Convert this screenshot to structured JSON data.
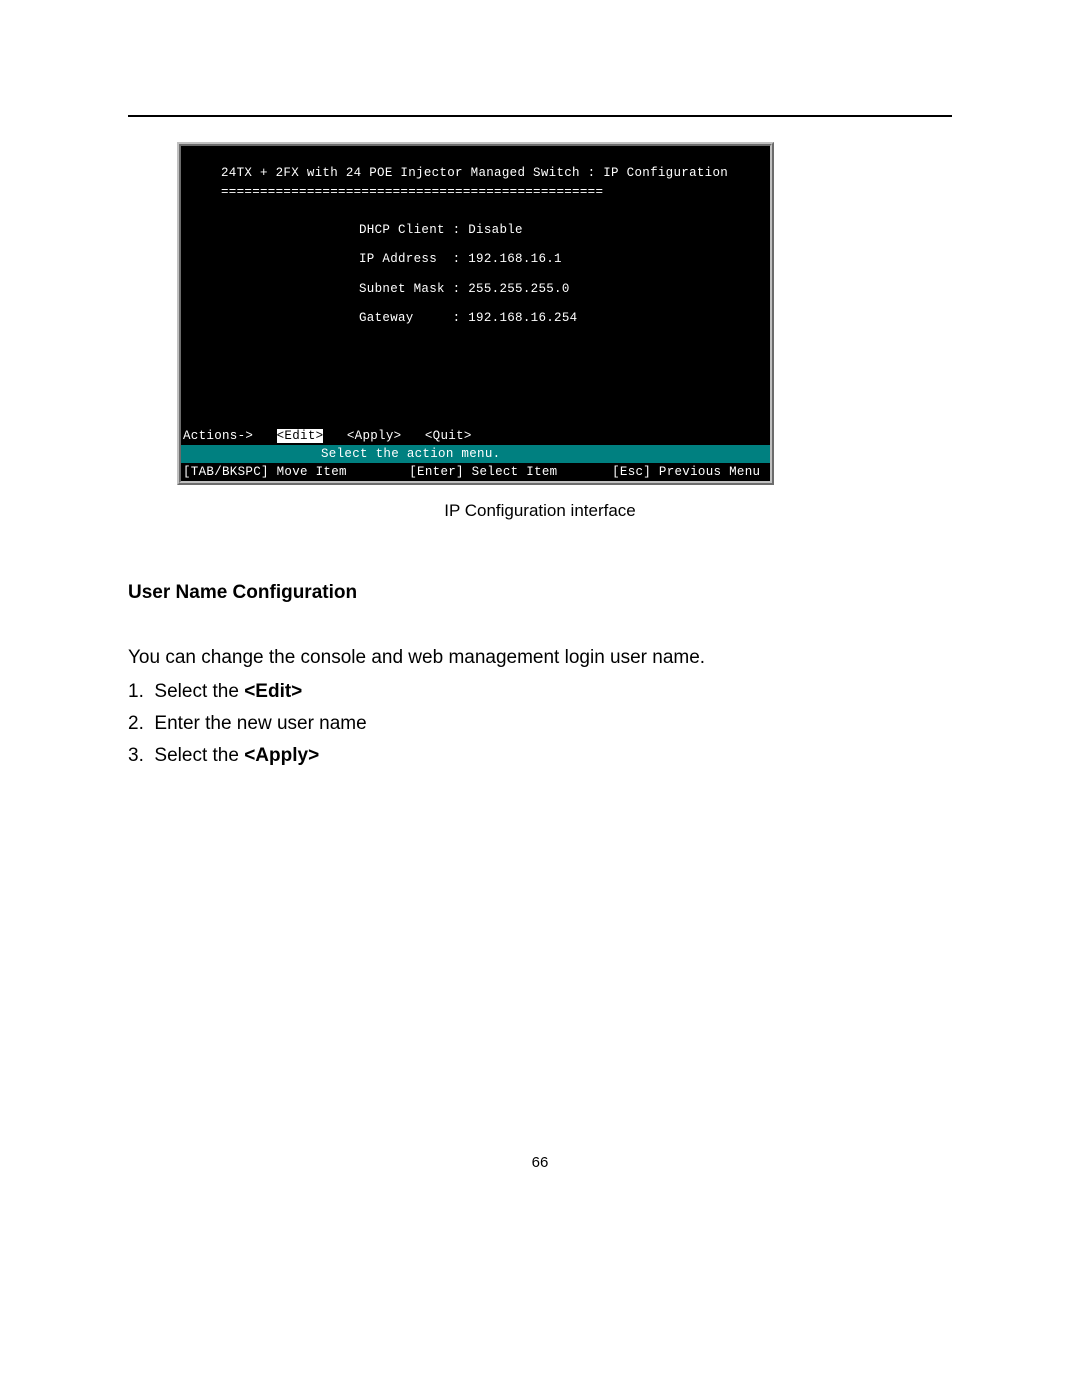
{
  "terminal": {
    "title": "24TX + 2FX with 24 POE Injector Managed Switch : IP Configuration",
    "divider": "=================================================",
    "fields": {
      "dhcp_label": "DHCP Client :",
      "dhcp_value": "Disable",
      "ip_label": "IP Address  :",
      "ip_value": "192.168.16.1",
      "subnet_label": "Subnet Mask :",
      "subnet_value": "255.255.255.0",
      "gateway_label": "Gateway     :",
      "gateway_value": "192.168.16.254"
    },
    "actions_prefix": "Actions->",
    "actions": {
      "edit": "<Edit>",
      "apply": "<Apply>",
      "quit": "<Quit>"
    },
    "hint": "Select the action menu.",
    "help": {
      "move": "[TAB/BKSPC] Move Item",
      "select": "[Enter] Select Item",
      "esc": "[Esc] Previous Menu"
    }
  },
  "caption": "IP Configuration interface",
  "section_heading": "User Name Configuration",
  "intro": "You can change the console and web management login user name.",
  "steps": {
    "s1_num": "1.",
    "s1_pre": "Select the ",
    "s1_bold": "<Edit>",
    "s2_num": "2.",
    "s2_text": "Enter the new user name",
    "s3_num": "3.",
    "s3_pre": "Select the ",
    "s3_bold": "<Apply>"
  },
  "page_number": "66"
}
